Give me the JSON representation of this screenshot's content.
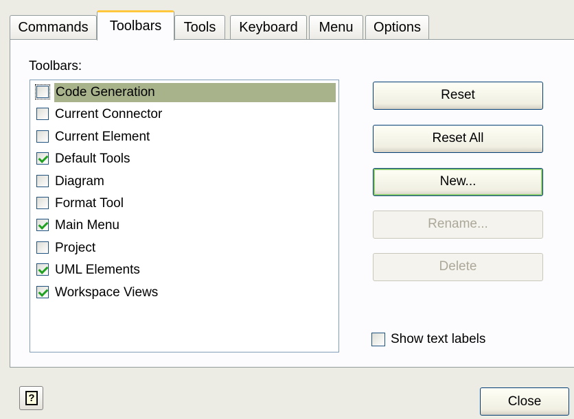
{
  "tabs": {
    "commands": "Commands",
    "toolbars": "Toolbars",
    "tools": "Tools",
    "keyboard": "Keyboard",
    "menu": "Menu",
    "options": "Options"
  },
  "toolbars_label": "Toolbars:",
  "toolbar_list": [
    {
      "label": "Code Generation",
      "checked": false,
      "selected": true
    },
    {
      "label": "Current Connector",
      "checked": false
    },
    {
      "label": "Current Element",
      "checked": false
    },
    {
      "label": "Default Tools",
      "checked": true
    },
    {
      "label": "Diagram",
      "checked": false
    },
    {
      "label": "Format Tool",
      "checked": false
    },
    {
      "label": "Main Menu",
      "checked": true
    },
    {
      "label": "Project",
      "checked": false
    },
    {
      "label": "UML Elements",
      "checked": true
    },
    {
      "label": "Workspace Views",
      "checked": true
    }
  ],
  "buttons": {
    "reset": "Reset",
    "reset_all": "Reset All",
    "new": "New...",
    "rename": "Rename...",
    "delete": "Delete"
  },
  "show_text_labels": {
    "label": "Show text labels",
    "checked": false
  },
  "footer": {
    "help_glyph": "?",
    "close": "Close"
  },
  "colors": {
    "selection": "#a8b38c",
    "active_tab_highlight": "#ffc83c",
    "check_mark": "#21a121"
  }
}
